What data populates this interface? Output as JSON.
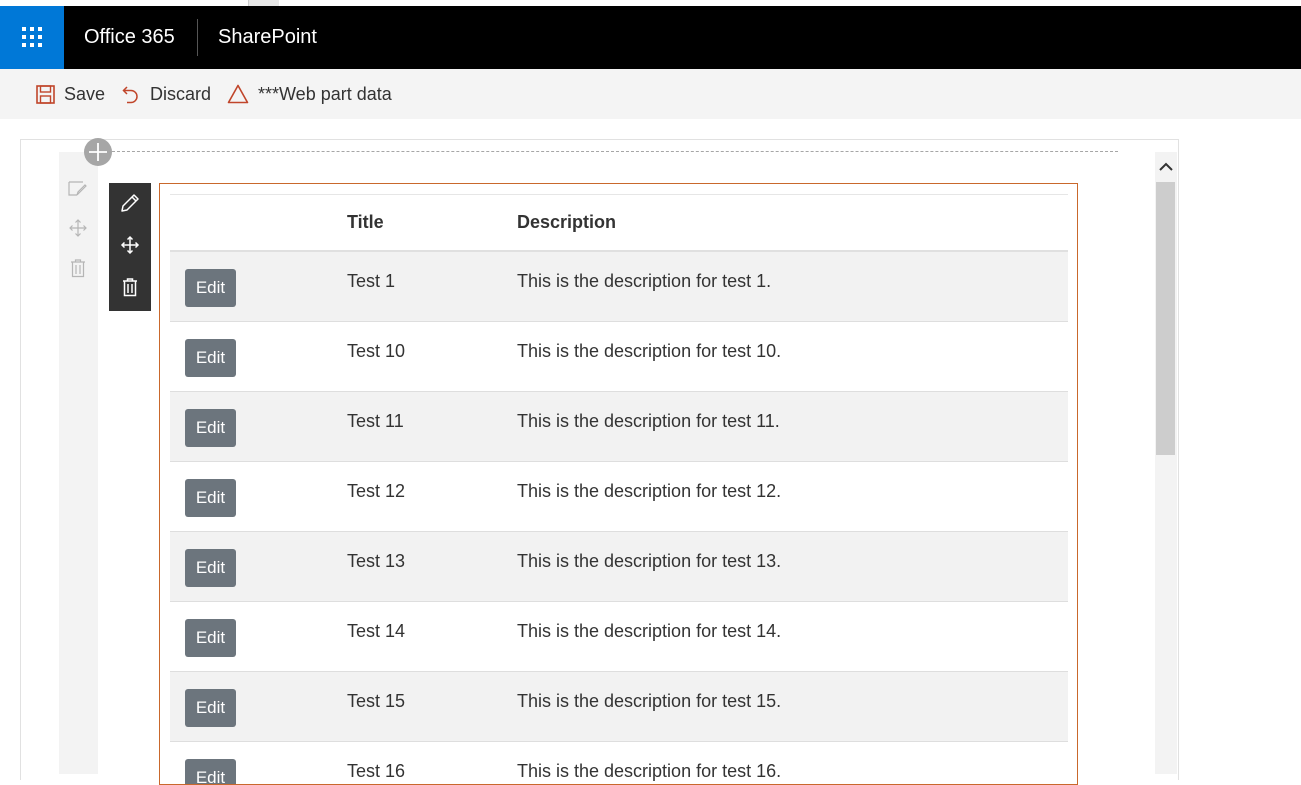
{
  "suite_bar": {
    "brand": "Office 365",
    "app_name": "SharePoint"
  },
  "command_bar": {
    "save_label": "Save",
    "discard_label": "Discard",
    "webpart_data_label": "***Web part data"
  },
  "table": {
    "columns": [
      "",
      "Title",
      "Description"
    ],
    "edit_label": "Edit",
    "rows": [
      {
        "title": "Test 1",
        "description": "This is the description for test 1."
      },
      {
        "title": "Test 10",
        "description": "This is the description for test 10."
      },
      {
        "title": "Test 11",
        "description": "This is the description for test 11."
      },
      {
        "title": "Test 12",
        "description": "This is the description for test 12."
      },
      {
        "title": "Test 13",
        "description": "This is the description for test 13."
      },
      {
        "title": "Test 14",
        "description": "This is the description for test 14."
      },
      {
        "title": "Test 15",
        "description": "This is the description for test 15."
      },
      {
        "title": "Test 16",
        "description": "This is the description for test 16."
      }
    ]
  },
  "icons": {
    "app_launcher": "waffle-icon",
    "save": "save-icon",
    "discard": "undo-icon",
    "webpart_data": "warning-triangle-icon",
    "add_section": "plus-icon",
    "zone_edit": "edit-icon",
    "zone_move": "move-icon",
    "zone_delete": "trash-icon",
    "scroll_up": "chevron-up-icon"
  },
  "colors": {
    "suite_bar": "#000000",
    "app_launcher": "#0078d7",
    "webpart_border": "#c9682c",
    "edit_button": "#6c757d",
    "webpart_toolbar": "#333333"
  }
}
